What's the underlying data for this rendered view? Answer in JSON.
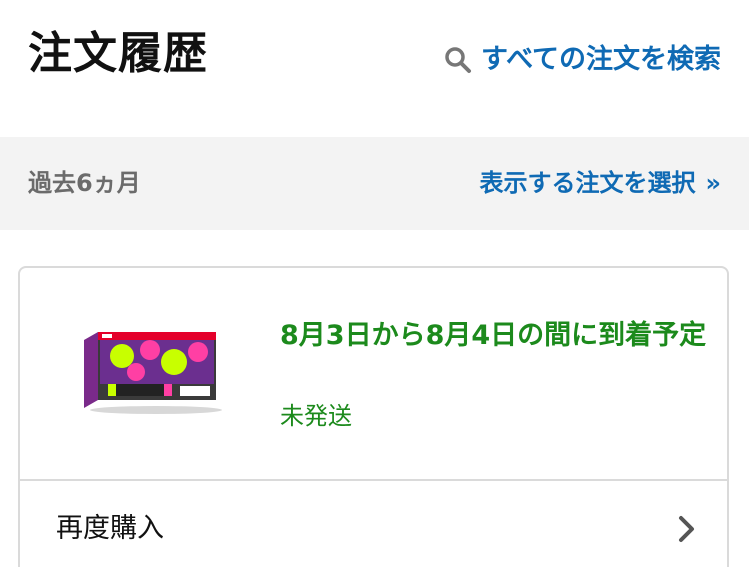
{
  "header": {
    "title": "注文履歴",
    "search_label": "すべての注文を検索",
    "search_icon": "search-icon"
  },
  "filter": {
    "period_label": "過去6ヵ月",
    "select_label": "表示する注文を選択",
    "select_chevron": "»"
  },
  "order": {
    "delivery_estimate": "8月3日から8月4日の間に到着予定",
    "shipping_status": "未発送",
    "product_image": "game-console-box-image",
    "buy_again_label": "再度購入",
    "buy_again_icon": "chevron-right-icon"
  },
  "colors": {
    "link": "#0f6ab4",
    "delivery_green": "#1c8a1c",
    "filter_bg": "#f3f3f3",
    "border": "#dadada"
  }
}
